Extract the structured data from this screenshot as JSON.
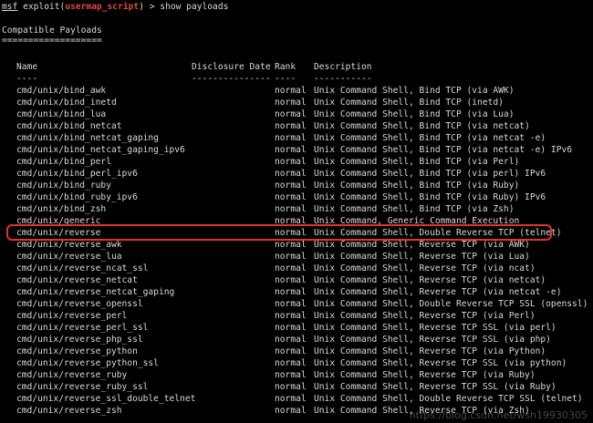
{
  "prompt": {
    "msf": "msf",
    "pre": " exploit(",
    "module": "usermap_script",
    "post": ") > show payloads"
  },
  "section_title": "Compatible Payloads",
  "section_underline": "===================",
  "headers": {
    "name": "Name",
    "date": "Disclosure Date",
    "rank": "Rank",
    "desc": "Description"
  },
  "header_rules": {
    "name": "----",
    "date": "---------------",
    "rank": "----",
    "desc": "-----------"
  },
  "payloads": [
    {
      "name": "cmd/unix/bind_awk",
      "rank": "normal",
      "desc": "Unix Command Shell, Bind TCP (via AWK)"
    },
    {
      "name": "cmd/unix/bind_inetd",
      "rank": "normal",
      "desc": "Unix Command Shell, Bind TCP (inetd)"
    },
    {
      "name": "cmd/unix/bind_lua",
      "rank": "normal",
      "desc": "Unix Command Shell, Bind TCP (via Lua)"
    },
    {
      "name": "cmd/unix/bind_netcat",
      "rank": "normal",
      "desc": "Unix Command Shell, Bind TCP (via netcat)"
    },
    {
      "name": "cmd/unix/bind_netcat_gaping",
      "rank": "normal",
      "desc": "Unix Command Shell, Bind TCP (via netcat -e)"
    },
    {
      "name": "cmd/unix/bind_netcat_gaping_ipv6",
      "rank": "normal",
      "desc": "Unix Command Shell, Bind TCP (via netcat -e) IPv6"
    },
    {
      "name": "cmd/unix/bind_perl",
      "rank": "normal",
      "desc": "Unix Command Shell, Bind TCP (via Perl)"
    },
    {
      "name": "cmd/unix/bind_perl_ipv6",
      "rank": "normal",
      "desc": "Unix Command Shell, Bind TCP (via perl) IPv6"
    },
    {
      "name": "cmd/unix/bind_ruby",
      "rank": "normal",
      "desc": "Unix Command Shell, Bind TCP (via Ruby)"
    },
    {
      "name": "cmd/unix/bind_ruby_ipv6",
      "rank": "normal",
      "desc": "Unix Command Shell, Bind TCP (via Ruby) IPv6"
    },
    {
      "name": "cmd/unix/bind_zsh",
      "rank": "normal",
      "desc": "Unix Command Shell, Bind TCP (via Zsh)"
    },
    {
      "name": "cmd/unix/generic",
      "rank": "normal",
      "desc": "Unix Command, Generic Command Execution"
    },
    {
      "name": "cmd/unix/reverse",
      "rank": "normal",
      "desc": "Unix Command Shell, Double Reverse TCP (telnet)"
    },
    {
      "name": "cmd/unix/reverse_awk",
      "rank": "normal",
      "desc": "Unix Command Shell, Reverse TCP (via AWK)"
    },
    {
      "name": "cmd/unix/reverse_lua",
      "rank": "normal",
      "desc": "Unix Command Shell, Reverse TCP (via Lua)"
    },
    {
      "name": "cmd/unix/reverse_ncat_ssl",
      "rank": "normal",
      "desc": "Unix Command Shell, Reverse TCP (via ncat)"
    },
    {
      "name": "cmd/unix/reverse_netcat",
      "rank": "normal",
      "desc": "Unix Command Shell, Reverse TCP (via netcat)"
    },
    {
      "name": "cmd/unix/reverse_netcat_gaping",
      "rank": "normal",
      "desc": "Unix Command Shell, Reverse TCP (via netcat -e)"
    },
    {
      "name": "cmd/unix/reverse_openssl",
      "rank": "normal",
      "desc": "Unix Command Shell, Double Reverse TCP SSL (openssl)"
    },
    {
      "name": "cmd/unix/reverse_perl",
      "rank": "normal",
      "desc": "Unix Command Shell, Reverse TCP (via Perl)"
    },
    {
      "name": "cmd/unix/reverse_perl_ssl",
      "rank": "normal",
      "desc": "Unix Command Shell, Reverse TCP SSL (via perl)"
    },
    {
      "name": "cmd/unix/reverse_php_ssl",
      "rank": "normal",
      "desc": "Unix Command Shell, Reverse TCP SSL (via php)"
    },
    {
      "name": "cmd/unix/reverse_python",
      "rank": "normal",
      "desc": "Unix Command Shell, Reverse TCP (via Python)"
    },
    {
      "name": "cmd/unix/reverse_python_ssl",
      "rank": "normal",
      "desc": "Unix Command Shell, Reverse TCP SSL (via python)"
    },
    {
      "name": "cmd/unix/reverse_ruby",
      "rank": "normal",
      "desc": "Unix Command Shell, Reverse TCP (via Ruby)"
    },
    {
      "name": "cmd/unix/reverse_ruby_ssl",
      "rank": "normal",
      "desc": "Unix Command Shell, Reverse TCP SSL (via Ruby)"
    },
    {
      "name": "cmd/unix/reverse_ssl_double_telnet",
      "rank": "normal",
      "desc": "Unix Command Shell, Double Reverse TCP SSL (telnet)"
    },
    {
      "name": "cmd/unix/reverse_zsh",
      "rank": "normal",
      "desc": "Unix Command Shell, Reverse TCP (via Zsh)"
    }
  ],
  "highlighted_row": 12,
  "highlight_color": "#e3332b",
  "prompt_module_color": "#e0473f",
  "watermark": "https://blog.csdn.net/wsh19930305"
}
